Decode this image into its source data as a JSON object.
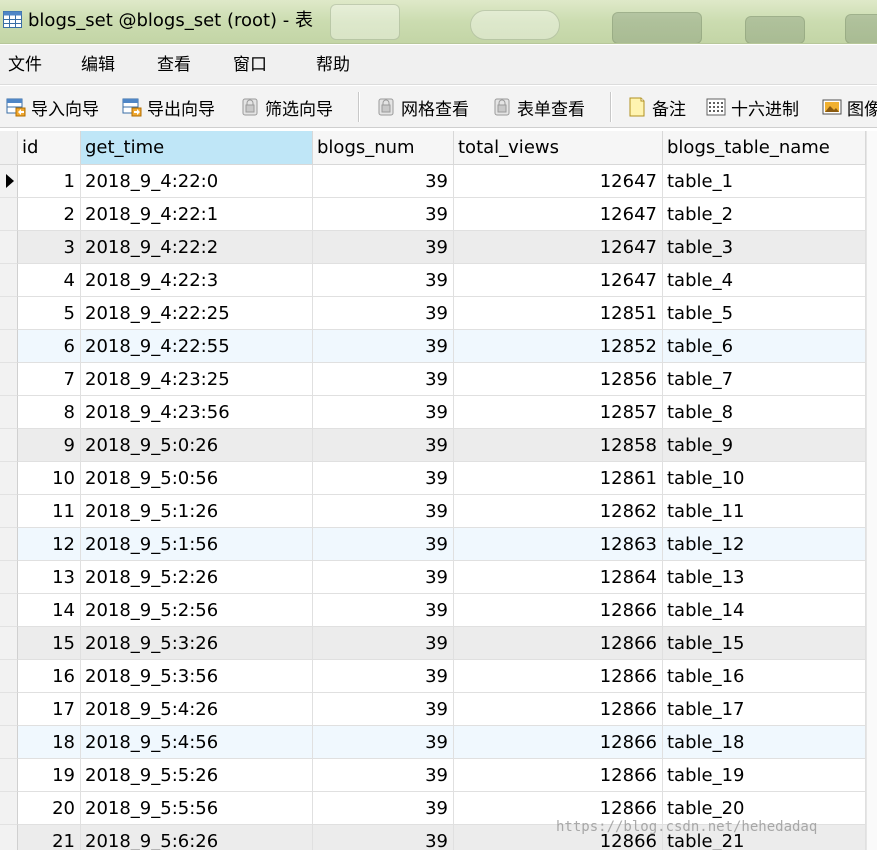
{
  "window": {
    "title": "blogs_set @blogs_set (root) - 表"
  },
  "menu": [
    "文件",
    "编辑",
    "查看",
    "窗口",
    "帮助"
  ],
  "toolbar": [
    {
      "label": "导入向导",
      "icon": "import-wizard-icon"
    },
    {
      "label": "导出向导",
      "icon": "export-wizard-icon"
    },
    {
      "label": "筛选向导",
      "icon": "filter-wizard-icon"
    },
    {
      "label": "网格查看",
      "icon": "grid-view-icon"
    },
    {
      "label": "表单查看",
      "icon": "form-view-icon"
    },
    {
      "label": "备注",
      "icon": "memo-icon"
    },
    {
      "label": "十六进制",
      "icon": "hex-icon"
    },
    {
      "label": "图像",
      "icon": "image-icon"
    }
  ],
  "table": {
    "columns": [
      "id",
      "get_time",
      "blogs_num",
      "total_views",
      "blogs_table_name"
    ],
    "rows": [
      [
        "1",
        "2018_9_4:22:0",
        "39",
        "12647",
        "table_1"
      ],
      [
        "2",
        "2018_9_4:22:1",
        "39",
        "12647",
        "table_2"
      ],
      [
        "3",
        "2018_9_4:22:2",
        "39",
        "12647",
        "table_3"
      ],
      [
        "4",
        "2018_9_4:22:3",
        "39",
        "12647",
        "table_4"
      ],
      [
        "5",
        "2018_9_4:22:25",
        "39",
        "12851",
        "table_5"
      ],
      [
        "6",
        "2018_9_4:22:55",
        "39",
        "12852",
        "table_6"
      ],
      [
        "7",
        "2018_9_4:23:25",
        "39",
        "12856",
        "table_7"
      ],
      [
        "8",
        "2018_9_4:23:56",
        "39",
        "12857",
        "table_8"
      ],
      [
        "9",
        "2018_9_5:0:26",
        "39",
        "12858",
        "table_9"
      ],
      [
        "10",
        "2018_9_5:0:56",
        "39",
        "12861",
        "table_10"
      ],
      [
        "11",
        "2018_9_5:1:26",
        "39",
        "12862",
        "table_11"
      ],
      [
        "12",
        "2018_9_5:1:56",
        "39",
        "12863",
        "table_12"
      ],
      [
        "13",
        "2018_9_5:2:26",
        "39",
        "12864",
        "table_13"
      ],
      [
        "14",
        "2018_9_5:2:56",
        "39",
        "12866",
        "table_14"
      ],
      [
        "15",
        "2018_9_5:3:26",
        "39",
        "12866",
        "table_15"
      ],
      [
        "16",
        "2018_9_5:3:56",
        "39",
        "12866",
        "table_16"
      ],
      [
        "17",
        "2018_9_5:4:26",
        "39",
        "12866",
        "table_17"
      ],
      [
        "18",
        "2018_9_5:4:56",
        "39",
        "12866",
        "table_18"
      ],
      [
        "19",
        "2018_9_5:5:26",
        "39",
        "12866",
        "table_19"
      ],
      [
        "20",
        "2018_9_5:5:56",
        "39",
        "12866",
        "table_20"
      ],
      [
        "21",
        "2018_9_5:6:26",
        "39",
        "12866",
        "table_21"
      ]
    ]
  },
  "watermark": "https://blog.csdn.net/hehedadaq",
  "colors": {
    "selected_header": "#bfe6f7",
    "row_blue": "#f0f8fe",
    "row_gray": "#ececec",
    "title_bar": "#cbdcb0"
  }
}
